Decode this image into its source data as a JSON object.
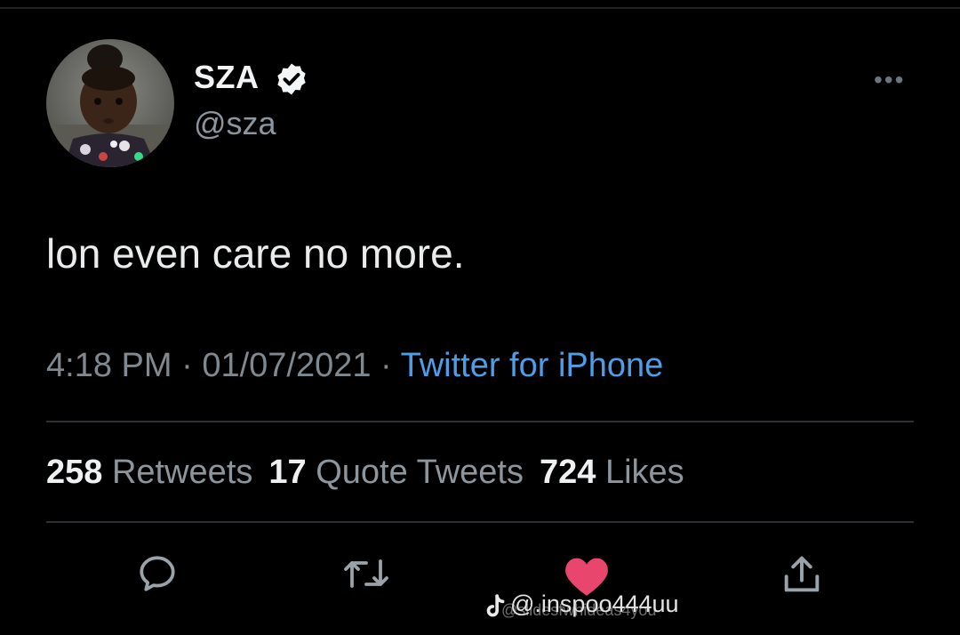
{
  "author": {
    "display_name": "SZA",
    "handle": "@sza",
    "verified": true
  },
  "tweet": {
    "text": "lon even care no more.",
    "time": "4:18 PM",
    "date": "01/07/2021",
    "separator": " · ",
    "source": "Twitter for iPhone"
  },
  "stats": {
    "retweets_count": "258",
    "retweets_label": "Retweets",
    "quotes_count": "17",
    "quotes_label": "Quote Tweets",
    "likes_count": "724",
    "likes_label": "Likes"
  },
  "menu": {
    "more_label": "•••"
  },
  "actions": [
    "reply-icon",
    "retweet-icon",
    "like-icon",
    "share-icon"
  ],
  "colors": {
    "background": "#000000",
    "link": "#4c9ee8",
    "like": "#e8466c"
  },
  "watermark": {
    "text": "@.inspoo444uu",
    "ghost_text": "@slidesfwhideas4you"
  }
}
